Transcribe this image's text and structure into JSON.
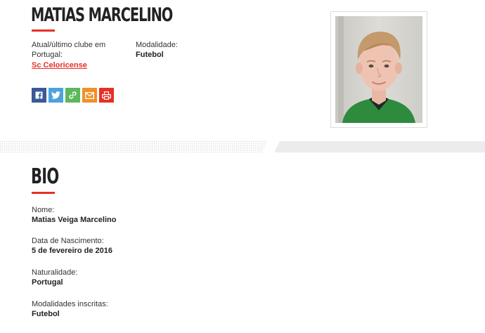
{
  "player": {
    "name": "MATIAS MARCELINO",
    "club_label": "Atual/último clube em Portugal:",
    "club_name": "Sc Celoricense",
    "modality_label": "Modalidade:",
    "modality_value": "Futebol"
  },
  "share_buttons": [
    {
      "icon": "facebook-icon",
      "color": "#3b5998"
    },
    {
      "icon": "twitter-icon",
      "color": "#4ba3e0"
    },
    {
      "icon": "link-icon",
      "color": "#5cb85c"
    },
    {
      "icon": "email-icon",
      "color": "#f0902a"
    },
    {
      "icon": "print-icon",
      "color": "#e63027"
    }
  ],
  "colors": {
    "accent": "#e63027",
    "shirt_green": "#2e8b3e"
  },
  "bio": {
    "title": "BIO",
    "fields": [
      {
        "label": "Nome:",
        "value": "Matias Veiga Marcelino"
      },
      {
        "label": "Data de Nascimento:",
        "value": "5 de fevereiro de 2016"
      },
      {
        "label": "Naturalidade:",
        "value": "Portugal"
      },
      {
        "label": "Modalidades inscritas:",
        "value": "Futebol"
      }
    ]
  }
}
